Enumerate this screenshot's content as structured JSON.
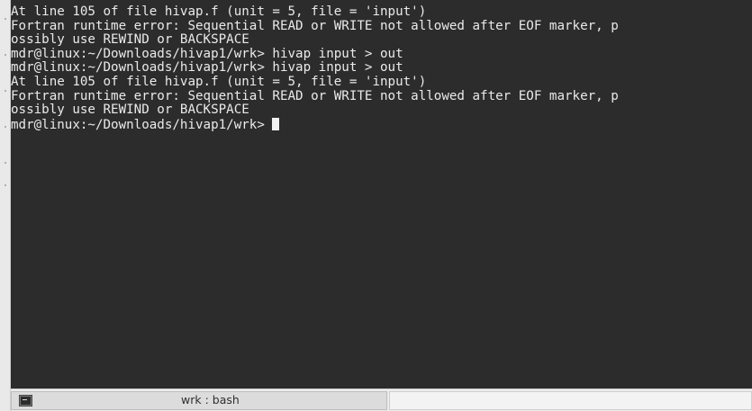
{
  "terminal": {
    "lines": [
      "At line 105 of file hivap.f (unit = 5, file = 'input')",
      "Fortran runtime error: Sequential READ or WRITE not allowed after EOF marker, p",
      "ossibly use REWIND or BACKSPACE",
      "mdr@linux:~/Downloads/hivap1/wrk> hivap input > out",
      "mdr@linux:~/Downloads/hivap1/wrk> hivap input > out",
      "At line 105 of file hivap.f (unit = 5, file = 'input')",
      "Fortran runtime error: Sequential READ or WRITE not allowed after EOF marker, p",
      "ossibly use REWIND or BACKSPACE"
    ],
    "prompt": "mdr@linux:~/Downloads/hivap1/wrk> "
  },
  "taskbar": {
    "task_label": "wrk : bash",
    "task_icon": "terminal-icon"
  }
}
